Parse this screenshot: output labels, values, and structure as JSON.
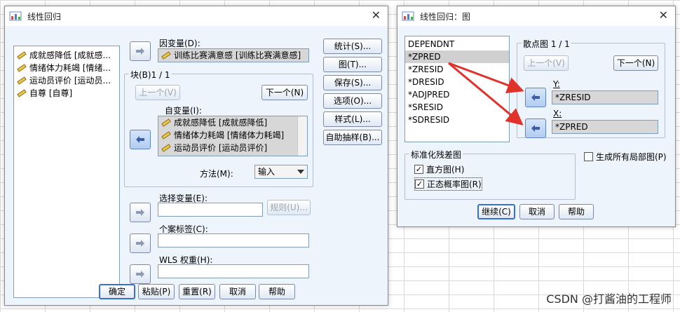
{
  "main": {
    "title": "线性回归",
    "variables": [
      "成就感降低 [成就感...",
      "情绪体力耗竭 [情绪...",
      "运动员评价 [运动员...",
      "自尊 [自尊]"
    ],
    "dependent_label": "因变量(D):",
    "dependent_value": "训练比赛满意感 [训练比赛满意感]",
    "block_label": "块(B)1 / 1",
    "prev_button": "上一个(V)",
    "next_button": "下一个(N)",
    "independent_label": "自变量(I):",
    "independent_values": [
      "成就感降低 [成就感降低]",
      "情绪体力耗竭 [情绪体力耗竭]",
      "运动员评价 [运动员评价]"
    ],
    "method_label": "方法(M):",
    "method_value": "输入",
    "selection_label": "选择变量(E):",
    "rule_button": "规则(U)...",
    "case_label": "个案标签(C):",
    "wls_label": "WLS 权重(H):",
    "side_buttons": [
      "统计(S)...",
      "图(T)...",
      "保存(S)...",
      "选项(O)...",
      "样式(L)...",
      "自助抽样(B)..."
    ],
    "bottom_buttons": [
      "确定",
      "粘贴(P)",
      "重置(R)",
      "取消",
      "帮助"
    ]
  },
  "plots": {
    "title": "线性回归：图",
    "source_list": [
      "DEPENDNT",
      "*ZPRED",
      "*ZRESID",
      "*DRESID",
      "*ADJPRED",
      "*SRESID",
      "*SDRESID"
    ],
    "scatter_group": "散点图 1 / 1",
    "prev_button": "上一个(V)",
    "next_button": "下一个(N)",
    "y_label": "Y:",
    "y_value": "*ZRESID",
    "x_label": "X:",
    "x_value": "*ZPRED",
    "std_group": "标准化残差图",
    "histogram": "直方图(H)",
    "normal_prob": "正态概率图(R)",
    "all_partial": "生成所有局部图(P)",
    "continue_button": "继续(C)",
    "cancel_button": "取消",
    "help_button": "帮助"
  },
  "watermark": "CSDN @打酱油的工程师",
  "colors": {
    "annotation_arrow": "#e0312b",
    "window_bg": "#eef4fb"
  }
}
